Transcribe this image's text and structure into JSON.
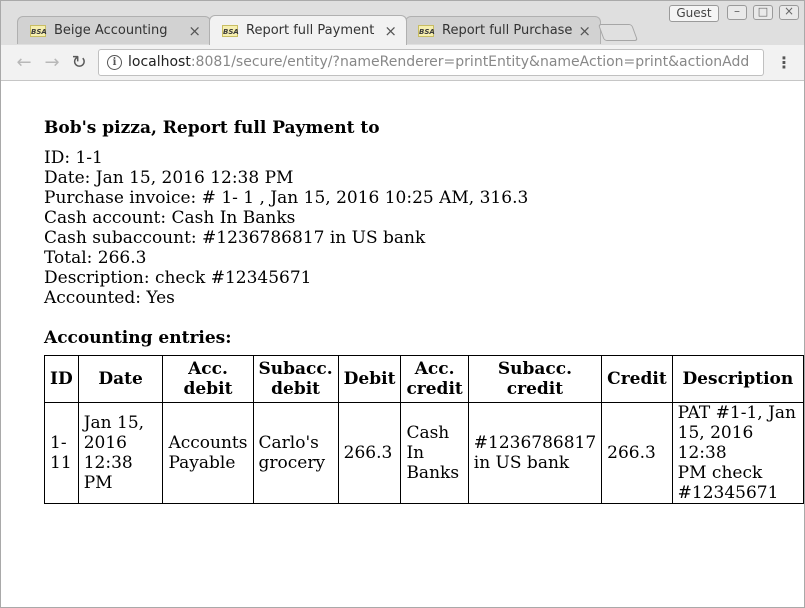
{
  "browser": {
    "tabs": [
      {
        "title": "Beige Accounting",
        "favicon": "BSA",
        "close": "×"
      },
      {
        "title": "Report full Payment",
        "favicon": "BSA",
        "close": "×"
      },
      {
        "title": "Report full Purchase",
        "favicon": "BSA",
        "close": "×"
      }
    ],
    "guest_label": "Guest",
    "url_host": "localhost",
    "url_rest": ":8081/secure/entity/?nameRenderer=printEntity&nameAction=print&actionAdd",
    "icons": {
      "back": "back-arrow-icon",
      "forward": "forward-arrow-icon",
      "reload": "reload-icon",
      "info": "info-icon",
      "menu": "menu-dots-icon"
    }
  },
  "report": {
    "title": "Bob's pizza, Report full Payment to",
    "fields": [
      "ID: 1-1",
      "Date: Jan 15, 2016 12:38 PM",
      "Purchase invoice: # 1- 1 , Jan 15, 2016 10:25 AM, 316.3",
      "Cash account: Cash In Banks",
      "Cash subaccount: #1236786817 in US bank",
      "Total: 266.3",
      "Description: check #12345671",
      "Accounted: Yes"
    ],
    "entries_title": "Accounting entries:",
    "entries_table": {
      "headers": [
        "ID",
        "Date",
        "Acc.\ndebit",
        "Subacc.\ndebit",
        "Debit",
        "Acc.\ncredit",
        "Subacc.\ncredit",
        "Credit",
        "Description"
      ],
      "rows": [
        [
          "1-\n11",
          "Jan 15,\n2016 12:38\nPM",
          "Accounts\nPayable",
          "Carlo's\ngrocery",
          "266.3",
          "Cash\nIn\nBanks",
          "#1236786817\nin US bank",
          "266.3",
          "PAT #1-1, Jan\n15, 2016 12:38\nPM check\n#12345671"
        ]
      ]
    }
  }
}
